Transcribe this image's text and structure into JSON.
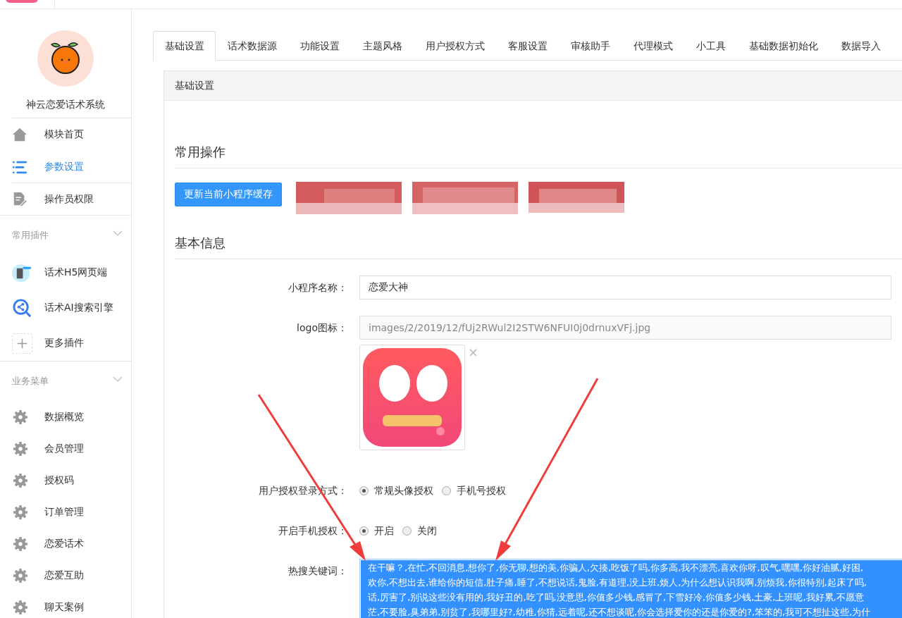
{
  "sidebar": {
    "brand": "神云恋爱话术系统",
    "items": [
      {
        "label": "模块首页",
        "kind": "home",
        "selected": false
      },
      {
        "label": "参数设置",
        "kind": "list",
        "selected": true
      },
      {
        "label": "操作员权限",
        "kind": "document",
        "selected": false
      }
    ],
    "groups": [
      {
        "title": "常用插件",
        "items": [
          {
            "label": "话术H5网页端",
            "kind": "phone"
          },
          {
            "label": "话术AI搜索引擎",
            "kind": "search"
          },
          {
            "label": "更多插件",
            "kind": "add"
          }
        ]
      },
      {
        "title": "业务菜单",
        "items": [
          {
            "label": "数据概览",
            "kind": "gear"
          },
          {
            "label": "会员管理",
            "kind": "gear"
          },
          {
            "label": "授权码",
            "kind": "gear"
          },
          {
            "label": "订单管理",
            "kind": "gear"
          },
          {
            "label": "恋爱话术",
            "kind": "gear"
          },
          {
            "label": "恋爱互助",
            "kind": "gear"
          },
          {
            "label": "聊天案例",
            "kind": "gear"
          }
        ]
      }
    ]
  },
  "tabs": [
    {
      "label": "基础设置",
      "selected": true
    },
    {
      "label": "话术数据源",
      "selected": false
    },
    {
      "label": "功能设置",
      "selected": false
    },
    {
      "label": "主题风格",
      "selected": false
    },
    {
      "label": "用户授权方式",
      "selected": false
    },
    {
      "label": "客服设置",
      "selected": false
    },
    {
      "label": "审核助手",
      "selected": false
    },
    {
      "label": "代理模式",
      "selected": false
    },
    {
      "label": "小工具",
      "selected": false
    },
    {
      "label": "基础数据初始化",
      "selected": false
    },
    {
      "label": "数据导入",
      "selected": false
    }
  ],
  "panel": {
    "title": "基础设置",
    "common": {
      "title": "常用操作",
      "button": "更新当前小程序缓存"
    },
    "basic": {
      "title": "基本信息",
      "fields": [
        {
          "kind": "text",
          "label": "小程序名称：",
          "value": "恋爱大神"
        },
        {
          "label": "logo图标：",
          "value": "images/2/2019/12/fUj2RWul2I2STW6NFUI0j0drnuxVFj.jpg",
          "remove": "×"
        },
        {
          "kind": "radio",
          "label": "用户授权登录方式：",
          "options": [
            {
              "label": "常规头像授权",
              "selected": true
            },
            {
              "label": "手机号授权",
              "selected": false
            }
          ]
        },
        {
          "kind": "radio",
          "label": "开启手机授权：",
          "options": [
            {
              "label": "开启",
              "selected": true
            },
            {
              "label": "关闭",
              "selected": false
            }
          ]
        },
        {
          "kind": "textarea",
          "label": "热搜关键词：",
          "lines": [
            "在干嘛？,在忙,不回消息,想你了,你无聊,想的美,你骗人,欠揍,吃饭了吗,你多高,我不漂亮,喜欢你呀,叹气,嘿嘿,你好油腻,好困,",
            "欢你,不想出去,谁给你的短信,肚子痛,睡了,不想说话,鬼脸,有道理,没上班,烦人,为什么想认识我啊,别烦我,你很特别,起床了吗,",
            "话,厉害了,别说这些没有用的,我好丑的,吃了吗,没意思,你值多少钱,感冒了,下雪好冷,你值多少钱,土豪,上班呢,我好累,不愿意",
            "茫,不要脸,臭弟弟,别贫了,我哪里好?,幼稚,你猜,远着呢,还不想谈呢,你会选择爱你的还是你爱的?,笨笨的,我可不想扯这些,为什"
          ]
        }
      ]
    }
  }
}
